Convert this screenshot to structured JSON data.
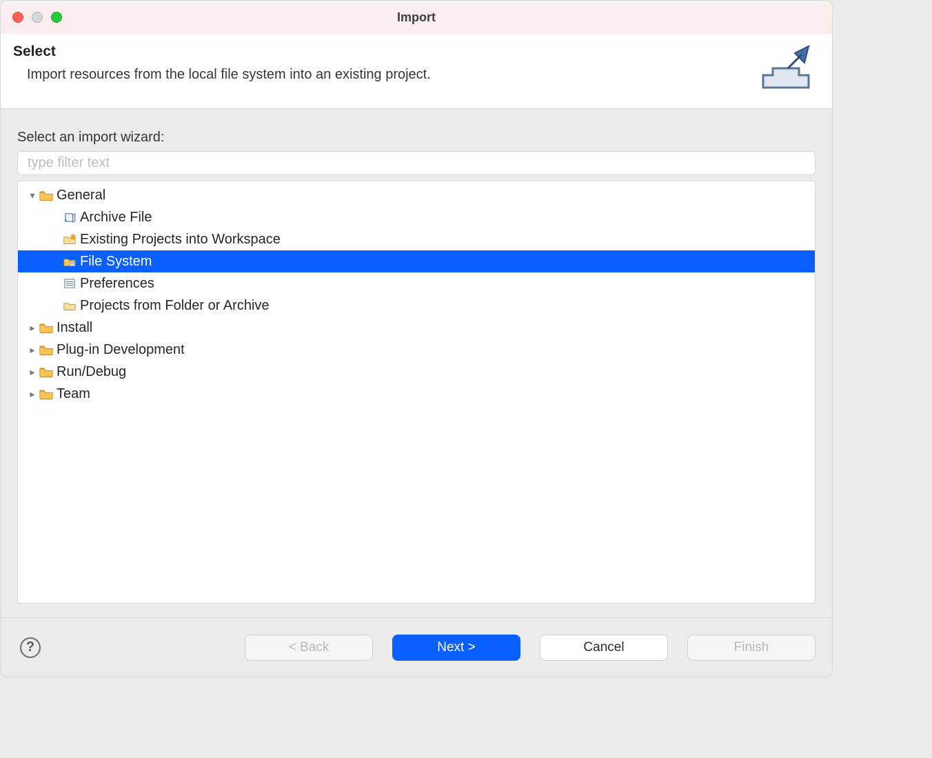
{
  "titlebar": {
    "title": "Import"
  },
  "header": {
    "heading": "Select",
    "description": "Import resources from the local file system into an existing project."
  },
  "body": {
    "wizard_label": "Select an import wizard:",
    "filter_placeholder": "type filter text",
    "filter_value": ""
  },
  "tree": {
    "categories": [
      {
        "id": "general",
        "label": "General",
        "expanded": true,
        "children": [
          {
            "id": "archive-file",
            "label": "Archive File",
            "icon": "archive"
          },
          {
            "id": "existing-projects",
            "label": "Existing Projects into Workspace",
            "icon": "project"
          },
          {
            "id": "file-system",
            "label": "File System",
            "icon": "filesystem",
            "selected": true
          },
          {
            "id": "preferences",
            "label": "Preferences",
            "icon": "prefs"
          },
          {
            "id": "projects-from-folder",
            "label": "Projects from Folder or Archive",
            "icon": "folder"
          }
        ]
      },
      {
        "id": "install",
        "label": "Install",
        "expanded": false
      },
      {
        "id": "plugin-dev",
        "label": "Plug-in Development",
        "expanded": false
      },
      {
        "id": "run-debug",
        "label": "Run/Debug",
        "expanded": false
      },
      {
        "id": "team",
        "label": "Team",
        "expanded": false
      }
    ]
  },
  "footer": {
    "help_tooltip": "Help",
    "back_label": "< Back",
    "back_enabled": false,
    "next_label": "Next >",
    "next_enabled": true,
    "cancel_label": "Cancel",
    "cancel_enabled": true,
    "finish_label": "Finish",
    "finish_enabled": false
  },
  "colors": {
    "selection": "#0a60ff",
    "folder_fill": "#f6c556",
    "folder_stroke": "#c79024"
  }
}
